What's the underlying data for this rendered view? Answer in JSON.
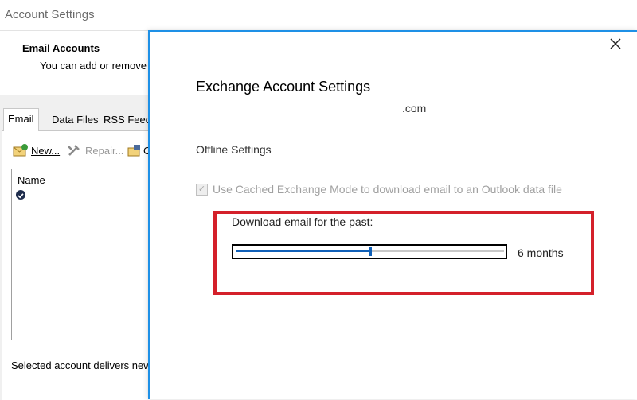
{
  "background_window": {
    "title": "Account Settings",
    "heading": "Email Accounts",
    "subtext": "You can add or remove",
    "tabs": [
      "Email",
      "Data Files",
      "RSS Feeds"
    ],
    "toolbar": {
      "new_label": "New...",
      "repair_label": "Repair...",
      "change_label": "C"
    },
    "list": {
      "column_name": "Name"
    },
    "footer_text": "Selected account delivers new"
  },
  "dialog": {
    "title": "Exchange Account Settings",
    "account": ".com",
    "section": "Offline Settings",
    "cached_mode": {
      "label": "Use Cached Exchange Mode to download email to an Outlook data file",
      "checked": true,
      "enabled": false
    },
    "download_label": "Download email for the past:",
    "slider": {
      "value_label": "6 months",
      "position": 0.5
    },
    "close_icon": "close-icon"
  },
  "colors": {
    "accent": "#1e90e6",
    "highlight": "#d4202a",
    "slider": "#1060b8"
  }
}
